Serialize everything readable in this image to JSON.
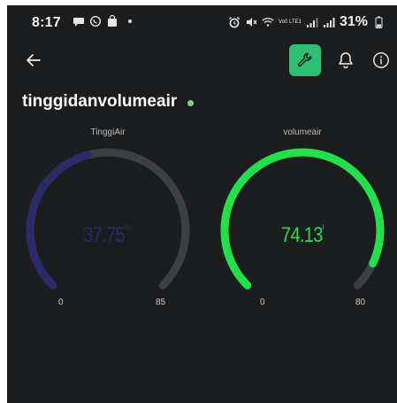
{
  "status_bar": {
    "time": "8:17",
    "network_label": "Vo0 LTE1",
    "battery": "31%"
  },
  "app_bar": {
    "back_icon": "arrow-left-icon",
    "settings_icon": "wrench-icon",
    "notification_icon": "bell-icon",
    "info_icon": "info-icon",
    "accent_color": "#2fbf71"
  },
  "device": {
    "title": "tinggidanvolumeair",
    "online_color": "#7fd67f"
  },
  "gauges": [
    {
      "label": "TinggiAir",
      "value": "37.75",
      "unit": "cm",
      "value_num": 37.75,
      "min": "0",
      "max": "85",
      "min_num": 0,
      "max_num": 85,
      "color": "#2a2c6a",
      "track_color": "#3d3f44"
    },
    {
      "label": "volumeair",
      "value": "74.13",
      "unit": "l",
      "value_num": 74.13,
      "min": "0",
      "max": "80",
      "min_num": 0,
      "max_num": 80,
      "color": "#22e04a",
      "track_color": "#3d3f44"
    }
  ]
}
